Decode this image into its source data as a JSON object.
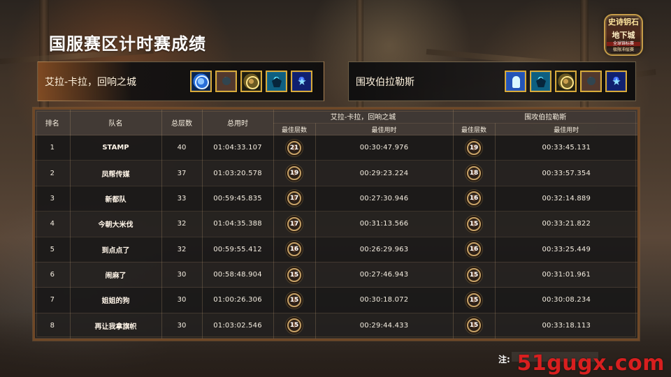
{
  "header": {
    "title": "国服赛区计时赛成绩"
  },
  "logo": {
    "line1": "史诗钥石",
    "line2": "地下城",
    "line3": "全球锦标赛",
    "line4": "极限冲层赛"
  },
  "dungeons": [
    {
      "name": "艾拉-卡拉，回响之城",
      "affixes": [
        {
          "icon": "blue-circle-affix-icon"
        },
        {
          "icon": "brown-figure-affix-icon"
        },
        {
          "icon": "gold-ring-affix-icon"
        },
        {
          "icon": "cyan-demon-affix-icon"
        },
        {
          "icon": "blue-star-affix-icon"
        }
      ]
    },
    {
      "name": "围攻伯拉勒斯",
      "affixes": [
        {
          "icon": "blue-figure-affix-icon"
        },
        {
          "icon": "cyan-demon-affix-icon"
        },
        {
          "icon": "gold-ring-affix-icon"
        },
        {
          "icon": "brown-figure-affix-icon"
        },
        {
          "icon": "blue-star-affix-icon"
        }
      ]
    }
  ],
  "table": {
    "headers": {
      "rank": "排名",
      "team": "队名",
      "total_levels": "总层数",
      "total_time": "总用时",
      "dungeon1": "艾拉-卡拉，回响之城",
      "dungeon2": "围攻伯拉勒斯",
      "best_level": "最佳层数",
      "best_time": "最佳用时"
    },
    "rows": [
      {
        "rank": "1",
        "team": "STAMP",
        "total_levels": "40",
        "total_time": "01:04:33.107",
        "d1_level": "21",
        "d1_time": "00:30:47.976",
        "d2_level": "19",
        "d2_time": "00:33:45.131"
      },
      {
        "rank": "2",
        "team": "凤帮传媒",
        "total_levels": "37",
        "total_time": "01:03:20.578",
        "d1_level": "19",
        "d1_time": "00:29:23.224",
        "d2_level": "18",
        "d2_time": "00:33:57.354"
      },
      {
        "rank": "3",
        "team": "新都队",
        "total_levels": "33",
        "total_time": "00:59:45.835",
        "d1_level": "17",
        "d1_time": "00:27:30.946",
        "d2_level": "16",
        "d2_time": "00:32:14.889"
      },
      {
        "rank": "4",
        "team": "今朝大米伐",
        "total_levels": "32",
        "total_time": "01:04:35.388",
        "d1_level": "17",
        "d1_time": "00:31:13.566",
        "d2_level": "15",
        "d2_time": "00:33:21.822"
      },
      {
        "rank": "5",
        "team": "到点点了",
        "total_levels": "32",
        "total_time": "00:59:55.412",
        "d1_level": "16",
        "d1_time": "00:26:29.963",
        "d2_level": "16",
        "d2_time": "00:33:25.449"
      },
      {
        "rank": "6",
        "team": "闹麻了",
        "total_levels": "30",
        "total_time": "00:58:48.904",
        "d1_level": "15",
        "d1_time": "00:27:46.943",
        "d2_level": "15",
        "d2_time": "00:31:01.961"
      },
      {
        "rank": "7",
        "team": "姐姐的狗",
        "total_levels": "30",
        "total_time": "01:00:26.306",
        "d1_level": "15",
        "d1_time": "00:30:18.072",
        "d2_level": "15",
        "d2_time": "00:30:08.234"
      },
      {
        "rank": "8",
        "team": "再让我拿旗帜",
        "total_levels": "30",
        "total_time": "01:03:02.546",
        "d1_level": "15",
        "d1_time": "00:29:44.433",
        "d2_level": "15",
        "d2_time": "00:33:18.113"
      }
    ]
  },
  "footer": {
    "note_prefix": "注:"
  },
  "watermark": {
    "text": "51gugx.com"
  }
}
